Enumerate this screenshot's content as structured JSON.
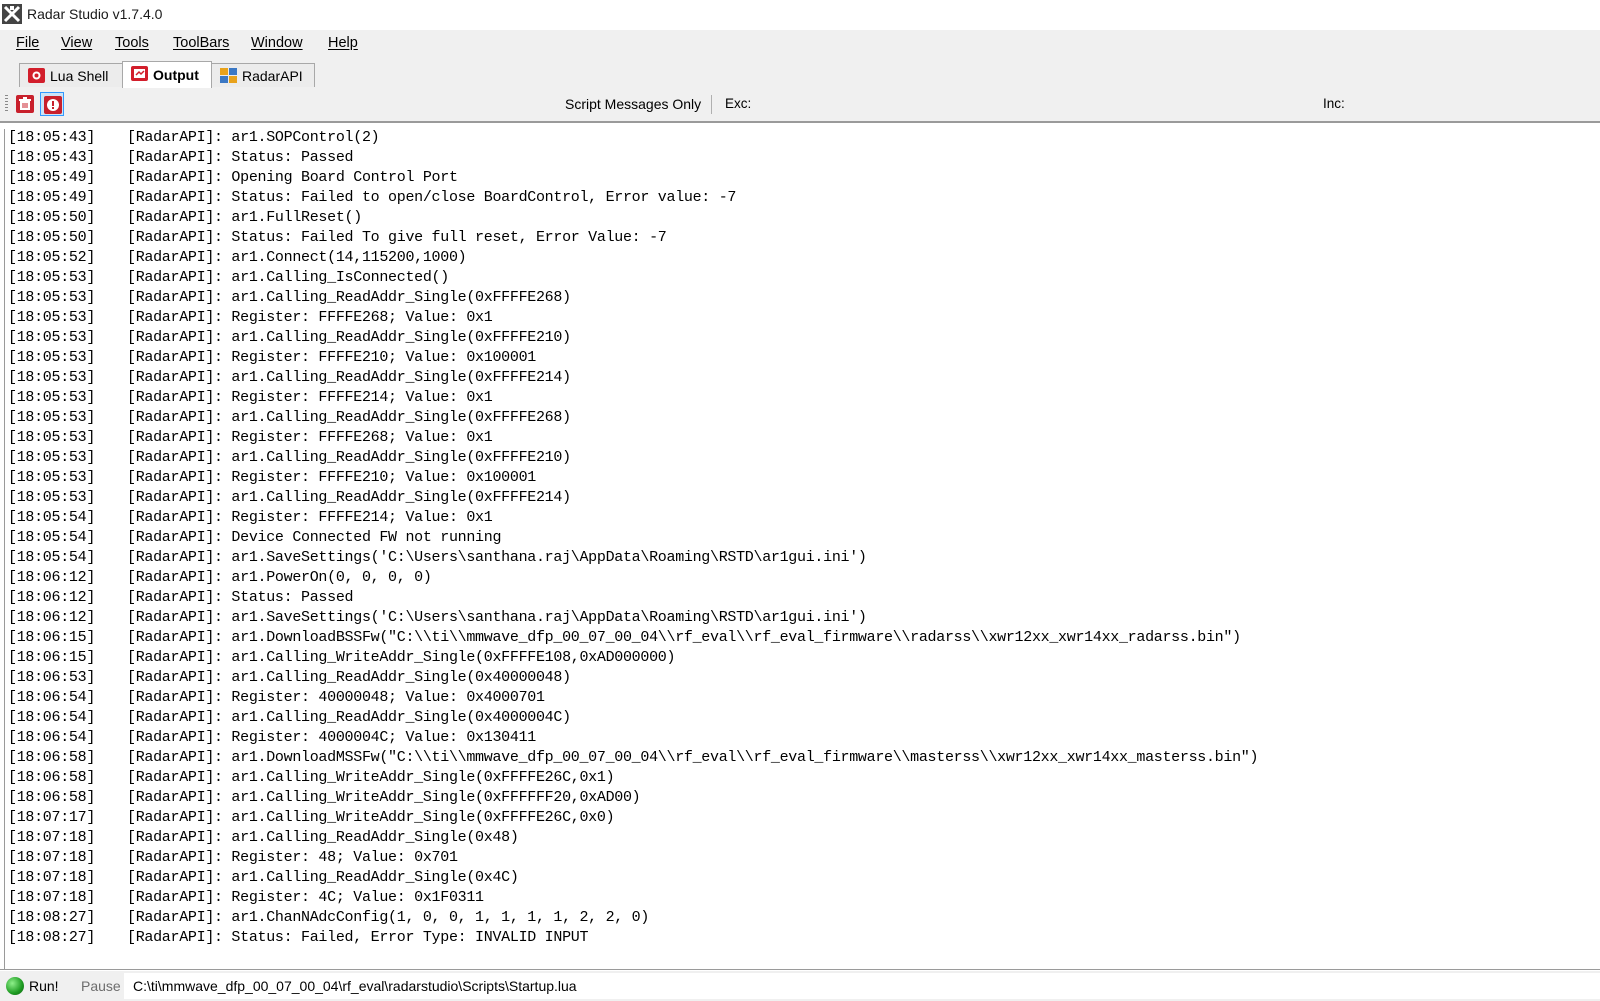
{
  "window": {
    "title": "Radar Studio v1.7.4.0"
  },
  "menu": [
    {
      "label": "File"
    },
    {
      "label": "View"
    },
    {
      "label": "Tools"
    },
    {
      "label": "ToolBars"
    },
    {
      "label": "Window"
    },
    {
      "label": "Help"
    }
  ],
  "tabs": [
    {
      "label": "Lua Shell",
      "icon": "lua-shell-icon",
      "active": false
    },
    {
      "label": "Output",
      "icon": "output-icon",
      "active": true
    },
    {
      "label": "RadarAPI",
      "icon": "radarapi-icon",
      "active": false
    }
  ],
  "toolbar": {
    "clear_icon": "clear-output-icon",
    "info_icon": "info-icon",
    "script_messages_only": "Script Messages Only",
    "exc_label": "Exc:",
    "exc_value": "",
    "inc_label": "Inc:",
    "inc_value": ""
  },
  "log": [
    {
      "time": "[18:05:43]",
      "msg": "[RadarAPI]: ar1.SOPControl(2)"
    },
    {
      "time": "[18:05:43]",
      "msg": "[RadarAPI]: Status: Passed"
    },
    {
      "time": "[18:05:49]",
      "msg": "[RadarAPI]: Opening Board Control Port"
    },
    {
      "time": "[18:05:49]",
      "msg": "[RadarAPI]: Status: Failed to open/close BoardControl, Error value: -7"
    },
    {
      "time": "[18:05:50]",
      "msg": "[RadarAPI]: ar1.FullReset()"
    },
    {
      "time": "[18:05:50]",
      "msg": "[RadarAPI]: Status: Failed To give full reset, Error Value: -7"
    },
    {
      "time": "[18:05:52]",
      "msg": "[RadarAPI]: ar1.Connect(14,115200,1000)"
    },
    {
      "time": "[18:05:53]",
      "msg": "[RadarAPI]: ar1.Calling_IsConnected()"
    },
    {
      "time": "[18:05:53]",
      "msg": "[RadarAPI]: ar1.Calling_ReadAddr_Single(0xFFFFE268)"
    },
    {
      "time": "[18:05:53]",
      "msg": "[RadarAPI]: Register: FFFFE268; Value: 0x1"
    },
    {
      "time": "[18:05:53]",
      "msg": "[RadarAPI]: ar1.Calling_ReadAddr_Single(0xFFFFE210)"
    },
    {
      "time": "[18:05:53]",
      "msg": "[RadarAPI]: Register: FFFFE210; Value: 0x100001"
    },
    {
      "time": "[18:05:53]",
      "msg": "[RadarAPI]: ar1.Calling_ReadAddr_Single(0xFFFFE214)"
    },
    {
      "time": "[18:05:53]",
      "msg": "[RadarAPI]: Register: FFFFE214; Value: 0x1"
    },
    {
      "time": "[18:05:53]",
      "msg": "[RadarAPI]: ar1.Calling_ReadAddr_Single(0xFFFFE268)"
    },
    {
      "time": "[18:05:53]",
      "msg": "[RadarAPI]: Register: FFFFE268; Value: 0x1"
    },
    {
      "time": "[18:05:53]",
      "msg": "[RadarAPI]: ar1.Calling_ReadAddr_Single(0xFFFFE210)"
    },
    {
      "time": "[18:05:53]",
      "msg": "[RadarAPI]: Register: FFFFE210; Value: 0x100001"
    },
    {
      "time": "[18:05:53]",
      "msg": "[RadarAPI]: ar1.Calling_ReadAddr_Single(0xFFFFE214)"
    },
    {
      "time": "[18:05:54]",
      "msg": "[RadarAPI]: Register: FFFFE214; Value: 0x1"
    },
    {
      "time": "[18:05:54]",
      "msg": "[RadarAPI]: Device Connected FW not running"
    },
    {
      "time": "[18:05:54]",
      "msg": "[RadarAPI]: ar1.SaveSettings('C:\\Users\\santhana.raj\\AppData\\Roaming\\RSTD\\ar1gui.ini')"
    },
    {
      "time": "[18:06:12]",
      "msg": "[RadarAPI]: ar1.PowerOn(0, 0, 0, 0)"
    },
    {
      "time": "[18:06:12]",
      "msg": "[RadarAPI]: Status: Passed"
    },
    {
      "time": "[18:06:12]",
      "msg": "[RadarAPI]: ar1.SaveSettings('C:\\Users\\santhana.raj\\AppData\\Roaming\\RSTD\\ar1gui.ini')"
    },
    {
      "time": "[18:06:15]",
      "msg": "[RadarAPI]: ar1.DownloadBSSFw(\"C:\\\\ti\\\\mmwave_dfp_00_07_00_04\\\\rf_eval\\\\rf_eval_firmware\\\\radarss\\\\xwr12xx_xwr14xx_radarss.bin\")"
    },
    {
      "time": "[18:06:15]",
      "msg": "[RadarAPI]: ar1.Calling_WriteAddr_Single(0xFFFFE108,0xAD000000)"
    },
    {
      "time": "[18:06:53]",
      "msg": "[RadarAPI]: ar1.Calling_ReadAddr_Single(0x40000048)"
    },
    {
      "time": "[18:06:54]",
      "msg": "[RadarAPI]: Register: 40000048; Value: 0x4000701"
    },
    {
      "time": "[18:06:54]",
      "msg": "[RadarAPI]: ar1.Calling_ReadAddr_Single(0x4000004C)"
    },
    {
      "time": "[18:06:54]",
      "msg": "[RadarAPI]: Register: 4000004C; Value: 0x130411"
    },
    {
      "time": "[18:06:58]",
      "msg": "[RadarAPI]: ar1.DownloadMSSFw(\"C:\\\\ti\\\\mmwave_dfp_00_07_00_04\\\\rf_eval\\\\rf_eval_firmware\\\\masterss\\\\xwr12xx_xwr14xx_masterss.bin\")"
    },
    {
      "time": "[18:06:58]",
      "msg": "[RadarAPI]: ar1.Calling_WriteAddr_Single(0xFFFFE26C,0x1)"
    },
    {
      "time": "[18:06:58]",
      "msg": "[RadarAPI]: ar1.Calling_WriteAddr_Single(0xFFFFFF20,0xAD00)"
    },
    {
      "time": "[18:07:17]",
      "msg": "[RadarAPI]: ar1.Calling_WriteAddr_Single(0xFFFFE26C,0x0)"
    },
    {
      "time": "[18:07:18]",
      "msg": "[RadarAPI]: ar1.Calling_ReadAddr_Single(0x48)"
    },
    {
      "time": "[18:07:18]",
      "msg": "[RadarAPI]: Register: 48; Value: 0x701"
    },
    {
      "time": "[18:07:18]",
      "msg": "[RadarAPI]: ar1.Calling_ReadAddr_Single(0x4C)"
    },
    {
      "time": "[18:07:18]",
      "msg": "[RadarAPI]: Register: 4C; Value: 0x1F0311"
    },
    {
      "time": "[18:08:27]",
      "msg": "[RadarAPI]: ar1.ChanNAdcConfig(1, 0, 0, 1, 1, 1, 1, 2, 2, 0)"
    },
    {
      "time": "[18:08:27]",
      "msg": "[RadarAPI]: Status: Failed, Error Type: INVALID INPUT"
    }
  ],
  "status": {
    "run_label": "Run!",
    "pause_label": "Pause",
    "script_path": "C:\\ti\\mmwave_dfp_00_07_00_04\\rf_eval\\radarstudio\\Scripts\\Startup.lua"
  }
}
